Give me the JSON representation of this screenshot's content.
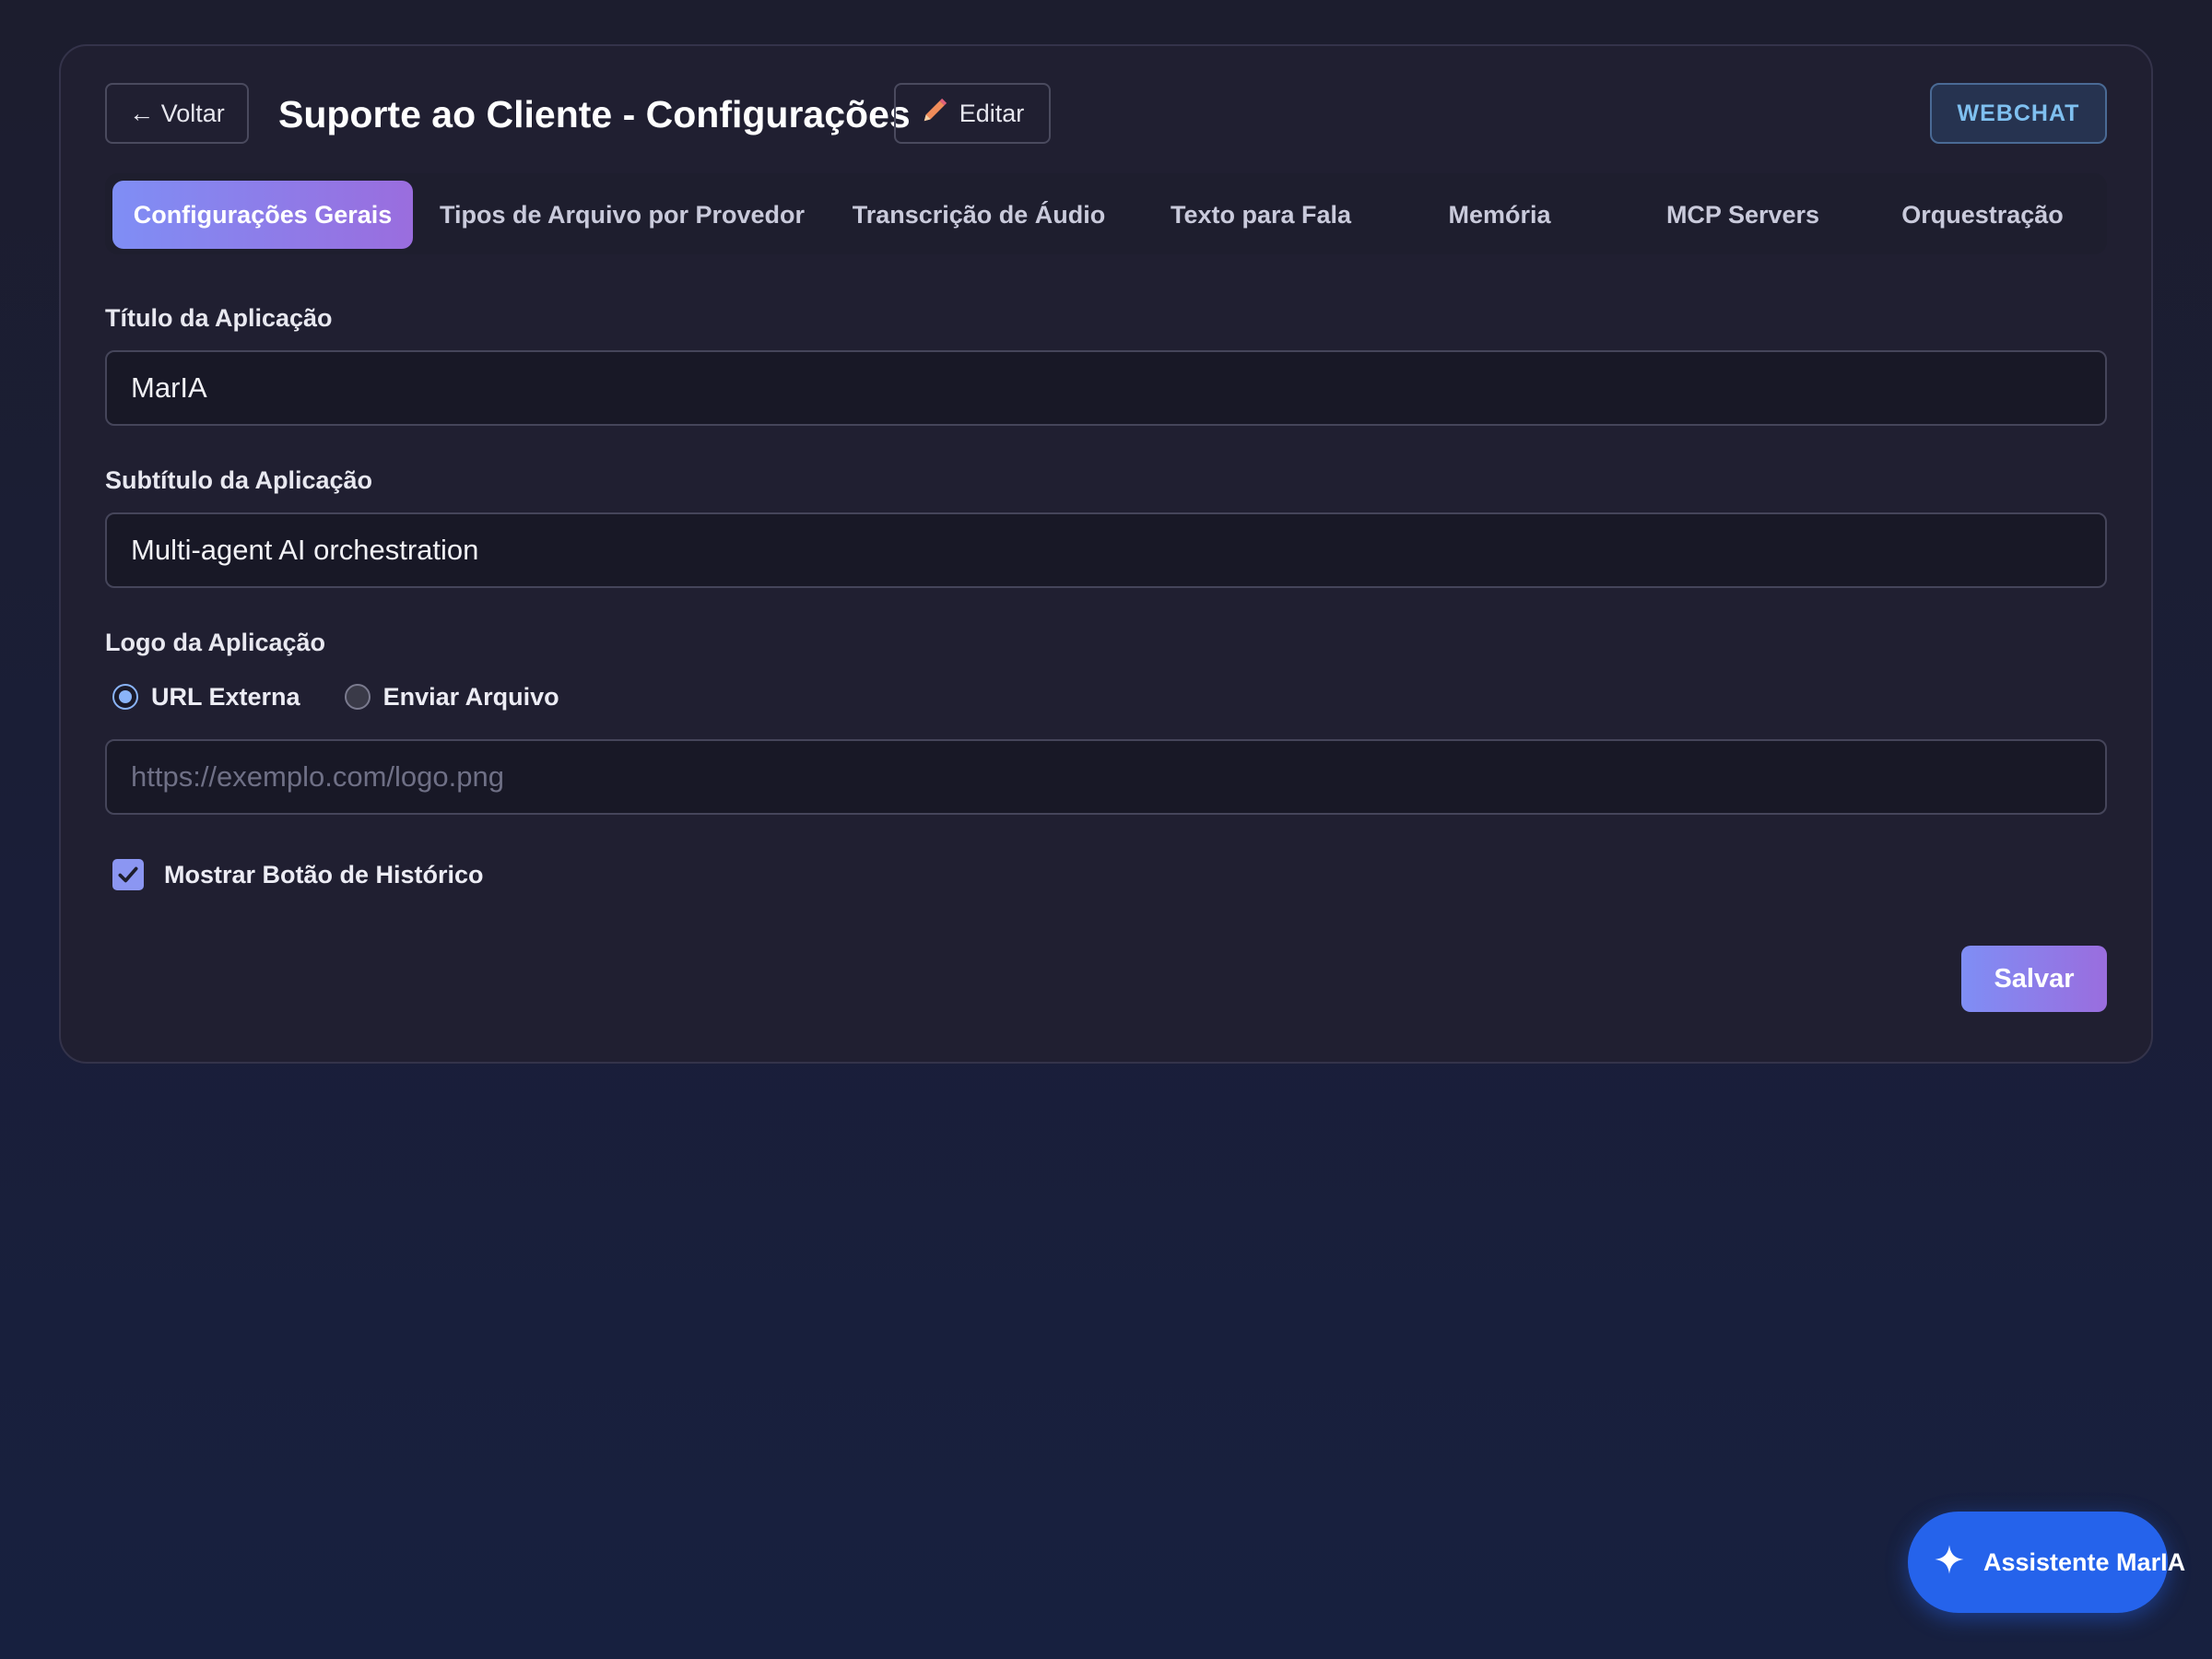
{
  "header": {
    "back_label": "← Voltar",
    "title": "Suporte ao Cliente - Configurações",
    "edit_label": "Editar",
    "badge": "WEBCHAT"
  },
  "tabs": [
    {
      "label": "Configurações Gerais",
      "active": true
    },
    {
      "label": "Tipos de Arquivo por Provedor",
      "active": false
    },
    {
      "label": "Transcrição de Áudio",
      "active": false
    },
    {
      "label": "Texto para Fala",
      "active": false
    },
    {
      "label": "Memória",
      "active": false
    },
    {
      "label": "MCP Servers",
      "active": false
    },
    {
      "label": "Orquestração",
      "active": false
    }
  ],
  "form": {
    "title_label": "Título da Aplicação",
    "title_value": "MarIA",
    "subtitle_label": "Subtítulo da Aplicação",
    "subtitle_value": "Multi-agent AI orchestration",
    "logo_label": "Logo da Aplicação",
    "logo_options": [
      {
        "label": "URL Externa",
        "selected": true
      },
      {
        "label": "Enviar Arquivo",
        "selected": false
      }
    ],
    "logo_url_placeholder": "https://exemplo.com/logo.png",
    "logo_url_value": "",
    "history_label": "Mostrar Botão de Histórico",
    "history_checked": true,
    "save_label": "Salvar"
  },
  "assistant": {
    "label": "Assistente MarIA"
  },
  "colors": {
    "accent_gradient_start": "#7f8ef5",
    "accent_gradient_end": "#9a6dde",
    "assistant_blue": "#2563eb",
    "badge_text": "#7fc0f0",
    "edit_pencil": "#f08c5a"
  },
  "icons": {
    "edit": "pencil-icon",
    "assistant": "sparkle-icon",
    "checkbox": "check-icon"
  }
}
